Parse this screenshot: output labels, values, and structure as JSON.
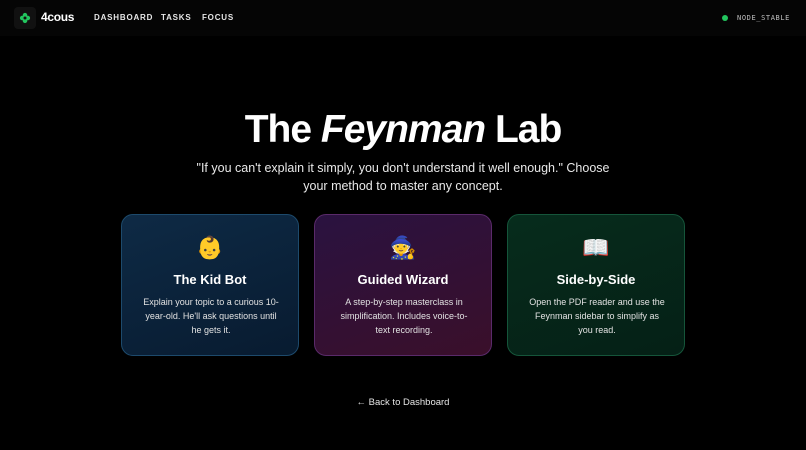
{
  "nav": {
    "brand": "4cous",
    "links": [
      "DASHBOARD",
      "TASKS",
      "FOCUS"
    ],
    "status": "NODE_STABLE",
    "status_color": "#22c55e",
    "logo_icon": "clover-icon",
    "logo_color": "#22c55e"
  },
  "hero": {
    "title_before": "The ",
    "title_italic": "Feynman",
    "title_after": " Lab",
    "subtitle": "\"If you can't explain it simply, you don't understand it well enough.\" Choose your method to master any concept."
  },
  "cards": [
    {
      "icon": "👶",
      "icon_name": "baby-icon",
      "title": "The Kid Bot",
      "description": "Explain your topic to a curious 10-year-old. He'll ask questions until he gets it."
    },
    {
      "icon": "🧙",
      "icon_name": "wizard-icon",
      "title": "Guided Wizard",
      "description": "A step-by-step masterclass in simplification. Includes voice-to-text recording."
    },
    {
      "icon": "📖",
      "icon_name": "open-book-icon",
      "title": "Side-by-Side",
      "description": "Open the PDF reader and use the Feynman sidebar to simplify as you read."
    }
  ],
  "back_link": "← Back to Dashboard"
}
